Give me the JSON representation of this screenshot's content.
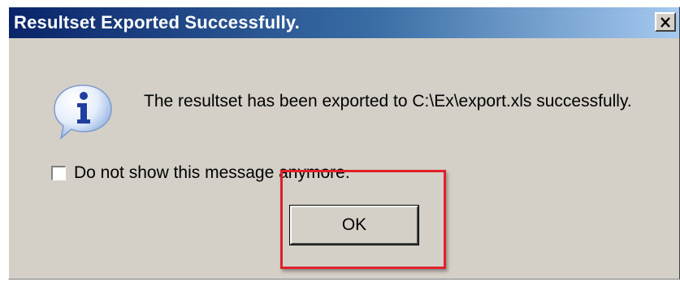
{
  "dialog": {
    "title": "Resultset Exported Successfully.",
    "message": "The resultset has been exported to C:\\Ex\\export.xls successfully.",
    "checkbox_label": "Do not show this message anymore.",
    "checkbox_checked": false,
    "ok_label": "OK",
    "close_label": "X"
  },
  "icons": {
    "message_icon": "info-icon",
    "close_icon": "close-icon"
  },
  "colors": {
    "title_bar_start": "#0a246a",
    "title_bar_end": "#a6caf0",
    "dialog_bg": "#d4d0c8",
    "highlight": "#e0202a"
  }
}
